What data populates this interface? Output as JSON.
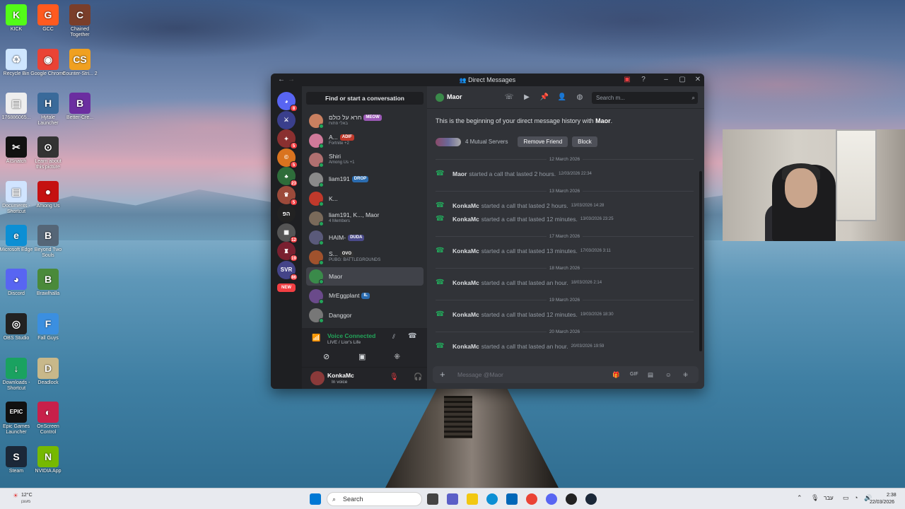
{
  "desktop": {
    "icons": [
      {
        "label": "KICK",
        "color": "#53fc18",
        "glyph": "K"
      },
      {
        "label": "GCC",
        "color": "#ff5a1f",
        "glyph": "G"
      },
      {
        "label": "Chained Together",
        "color": "#7a3e2a",
        "glyph": "C"
      },
      {
        "label": "Recycle Bin",
        "color": "#cfe6ff",
        "glyph": "♻"
      },
      {
        "label": "Google Chrome",
        "color": "#ea4335",
        "glyph": "◉"
      },
      {
        "label": "Counter-Stri... 2",
        "color": "#f0a020",
        "glyph": "CS"
      },
      {
        "label": "176886065...",
        "color": "#eeeeee",
        "glyph": "▤"
      },
      {
        "label": "Hytale Launcher",
        "color": "#3a6a9a",
        "glyph": "H"
      },
      {
        "label": "Better-Cre...",
        "color": "#6b2ea0",
        "glyph": "B"
      },
      {
        "label": "AISnatch",
        "color": "#111111",
        "glyph": "✂"
      },
      {
        "label": "Learn about this picture",
        "color": "#333333",
        "glyph": "⊙"
      },
      {
        "label": "Documents - Shortcut",
        "color": "#d0e4ff",
        "glyph": "▤"
      },
      {
        "label": "Among Us",
        "color": "#c51111",
        "glyph": "●"
      },
      {
        "label": "Microsoft Edge",
        "color": "#0c8fd4",
        "glyph": "e"
      },
      {
        "label": "Beyond Two Souls",
        "color": "#556677",
        "glyph": "B"
      },
      {
        "label": "Discord",
        "color": "#5865f2",
        "glyph": "◕"
      },
      {
        "label": "Brawlhalla",
        "color": "#4a8a3a",
        "glyph": "B"
      },
      {
        "label": "OBS Studio",
        "color": "#222222",
        "glyph": "◎"
      },
      {
        "label": "Fall Guys",
        "color": "#3b8fe0",
        "glyph": "F"
      },
      {
        "label": "Downloads - Shortcut",
        "color": "#1aa260",
        "glyph": "↓"
      },
      {
        "label": "Deadlock",
        "color": "#c8b88a",
        "glyph": "D"
      },
      {
        "label": "Epic Games Launcher",
        "color": "#111111",
        "glyph": "EPIC"
      },
      {
        "label": "OnScreen Control",
        "color": "#c8204a",
        "glyph": "◐"
      },
      {
        "label": "Steam",
        "color": "#1b2838",
        "glyph": "S"
      },
      {
        "label": "NVIDIA App",
        "color": "#76b900",
        "glyph": "N"
      }
    ]
  },
  "window": {
    "title": "Direct Messages"
  },
  "servers": [
    {
      "color": "#5865f2",
      "badge": "8",
      "glyph": "◕"
    },
    {
      "color": "#3a3f8c",
      "badge": "",
      "glyph": "⚔"
    },
    {
      "color": "#8a3030",
      "badge": "5",
      "glyph": "✦"
    },
    {
      "color": "#d9731f",
      "badge": "5",
      "glyph": "©"
    },
    {
      "color": "#2e6d3a",
      "badge": "23",
      "glyph": "♣"
    },
    {
      "color": "#9c4a3a",
      "badge": "5",
      "glyph": "♛"
    },
    {
      "color": "#222222",
      "badge": "",
      "glyph": "הפ"
    },
    {
      "color": "#555555",
      "badge": "12",
      "glyph": "▦"
    },
    {
      "color": "#7a2030",
      "badge": "19",
      "glyph": "♜"
    },
    {
      "color": "#444488",
      "badge": "86",
      "glyph": "SVR"
    },
    {
      "color": "#f23f43",
      "badge": "",
      "glyph": "NEW"
    }
  ],
  "dmlist": {
    "find_label": "Find or start a conversation",
    "items": [
      {
        "name": "חרא על כולם",
        "sub": "באלי פתוח",
        "tag": "MEOW",
        "tag_color": "#9b59b6",
        "avatar": "#c98060"
      },
      {
        "name": "A...",
        "sub": "Fortnite +2",
        "tag": "ADIF",
        "tag_color": "#c0392b",
        "avatar": "#d07a9a"
      },
      {
        "name": "Shiri",
        "sub": "Among Us +1",
        "tag": "",
        "tag_color": "",
        "avatar": "#b07070"
      },
      {
        "name": "liam191",
        "sub": "",
        "tag": "DROP",
        "tag_color": "#2b6cb0",
        "avatar": "#8a8a8a"
      },
      {
        "name": "K...",
        "sub": "",
        "tag": "",
        "tag_color": "",
        "avatar": "#c0392b"
      },
      {
        "name": "liam191, K..., Maor",
        "sub": "4 Members",
        "tag": "",
        "tag_color": "",
        "avatar": "#7a6a5a"
      },
      {
        "name": "HAIM-",
        "sub": "",
        "tag": "DUDA",
        "tag_color": "#4a4a8a",
        "avatar": "#5a5a7a"
      },
      {
        "name": "S...",
        "sub": "PUBG: BATTLEGROUNDS",
        "tag": "OVO",
        "tag_color": "#333333",
        "avatar": "#a0522d"
      },
      {
        "name": "Maor",
        "sub": "",
        "tag": "",
        "tag_color": "",
        "avatar": "#3a8a4a"
      },
      {
        "name": "MrEggplant",
        "sub": "",
        "tag": "IL",
        "tag_color": "#2b6cb0",
        "avatar": "#6a4a8a"
      },
      {
        "name": "Danggor",
        "sub": "",
        "tag": "",
        "tag_color": "",
        "avatar": "#777777"
      }
    ]
  },
  "voice": {
    "status": "Voice Connected",
    "channel": "LIVE / Lior's Life"
  },
  "user": {
    "name": "KonkaMc",
    "status": "In voice"
  },
  "chat": {
    "recipient": "Maor",
    "search_placeholder": "Search m...",
    "intro_prefix": "This is the beginning of your direct message history with ",
    "intro_name": "Maor",
    "mutual_servers": "4 Mutual Servers",
    "remove_friend": "Remove Friend",
    "block": "Block",
    "composer_placeholder": "Message @Maor",
    "entries": [
      {
        "type": "date",
        "text": "12 March 2026"
      },
      {
        "type": "call",
        "who": "Maor",
        "text": "started a call that lasted 2 hours.",
        "ts": "12/03/2026 22:34"
      },
      {
        "type": "date",
        "text": "13 March 2026"
      },
      {
        "type": "call",
        "who": "KonkaMc",
        "text": "started a call that lasted 2 hours.",
        "ts": "13/03/2026 14:28"
      },
      {
        "type": "call",
        "who": "KonkaMc",
        "text": "started a call that lasted 12 minutes.",
        "ts": "13/03/2026 23:25"
      },
      {
        "type": "date",
        "text": "17 March 2026"
      },
      {
        "type": "call",
        "who": "KonkaMc",
        "text": "started a call that lasted 13 minutes.",
        "ts": "17/03/2026 3:11"
      },
      {
        "type": "date",
        "text": "18 March 2026"
      },
      {
        "type": "call",
        "who": "KonkaMc",
        "text": "started a call that lasted an hour.",
        "ts": "18/03/2026 2:14"
      },
      {
        "type": "date",
        "text": "19 March 2026"
      },
      {
        "type": "call",
        "who": "KonkaMc",
        "text": "started a call that lasted 12 minutes.",
        "ts": "19/03/2026 18:30"
      },
      {
        "type": "date",
        "text": "20 March 2026"
      },
      {
        "type": "call",
        "who": "KonkaMc",
        "text": "started a call that lasted an hour.",
        "ts": "20/03/2026 19:59"
      }
    ]
  },
  "taskbar": {
    "weather": "12°C",
    "weather_sub": "מעונן",
    "search_label": "Search",
    "lang": "עבר",
    "time": "2:38",
    "date": "22/03/2026"
  }
}
